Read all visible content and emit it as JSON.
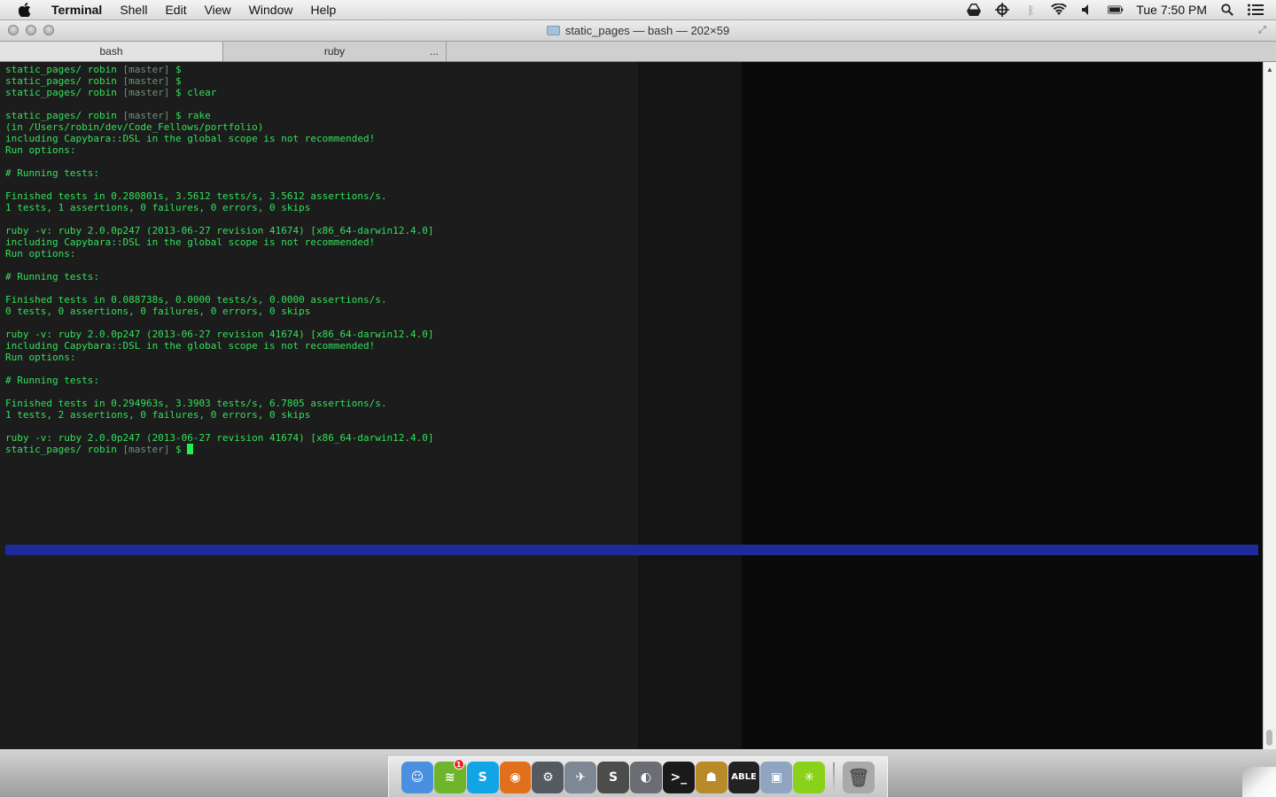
{
  "menubar": {
    "app_name": "Terminal",
    "items": [
      "Shell",
      "Edit",
      "View",
      "Window",
      "Help"
    ],
    "clock": "Tue 7:50 PM"
  },
  "window": {
    "title": "static_pages — bash — 202×59",
    "tabs": [
      {
        "label": "bash",
        "active": true
      },
      {
        "label": "ruby",
        "active": false,
        "extra": "..."
      }
    ]
  },
  "terminal": {
    "lines": [
      [
        {
          "t": "static_pages/ robin "
        },
        {
          "t": "[master]",
          "d": true
        },
        {
          "t": " $"
        }
      ],
      [
        {
          "t": "static_pages/ robin "
        },
        {
          "t": "[master]",
          "d": true
        },
        {
          "t": " $"
        }
      ],
      [
        {
          "t": "static_pages/ robin "
        },
        {
          "t": "[master]",
          "d": true
        },
        {
          "t": " $ clear"
        }
      ],
      [],
      [
        {
          "t": "static_pages/ robin "
        },
        {
          "t": "[master]",
          "d": true
        },
        {
          "t": " $ rake"
        }
      ],
      [
        {
          "t": "(in /Users/robin/dev/Code_Fellows/portfolio)"
        }
      ],
      [
        {
          "t": "including Capybara::DSL in the global scope is not recommended!"
        }
      ],
      [
        {
          "t": "Run options:"
        }
      ],
      [],
      [
        {
          "t": "# Running tests:"
        }
      ],
      [],
      [
        {
          "t": "Finished tests in 0.280801s, 3.5612 tests/s, 3.5612 assertions/s."
        }
      ],
      [
        {
          "t": "1 tests, 1 assertions, 0 failures, 0 errors, 0 skips"
        }
      ],
      [],
      [
        {
          "t": "ruby -v: ruby 2.0.0p247 (2013-06-27 revision 41674) [x86_64-darwin12.4.0]"
        }
      ],
      [
        {
          "t": "including Capybara::DSL in the global scope is not recommended!"
        }
      ],
      [
        {
          "t": "Run options:"
        }
      ],
      [],
      [
        {
          "t": "# Running tests:"
        }
      ],
      [],
      [
        {
          "t": "Finished tests in 0.088738s, 0.0000 tests/s, 0.0000 assertions/s."
        }
      ],
      [
        {
          "t": "0 tests, 0 assertions, 0 failures, 0 errors, 0 skips"
        }
      ],
      [],
      [
        {
          "t": "ruby -v: ruby 2.0.0p247 (2013-06-27 revision 41674) [x86_64-darwin12.4.0]"
        }
      ],
      [
        {
          "t": "including Capybara::DSL in the global scope is not recommended!"
        }
      ],
      [
        {
          "t": "Run options:"
        }
      ],
      [],
      [
        {
          "t": "# Running tests:"
        }
      ],
      [],
      [
        {
          "t": "Finished tests in 0.294963s, 3.3903 tests/s, 6.7805 assertions/s."
        }
      ],
      [
        {
          "t": "1 tests, 2 assertions, 0 failures, 0 errors, 0 skips"
        }
      ],
      [],
      [
        {
          "t": "ruby -v: ruby 2.0.0p247 (2013-06-27 revision 41674) [x86_64-darwin12.4.0]"
        }
      ],
      [
        {
          "t": "static_pages/ robin "
        },
        {
          "t": "[master]",
          "d": true
        },
        {
          "t": " $ "
        }
      ]
    ]
  },
  "dock": {
    "apps": [
      {
        "name": "finder-icon",
        "color": "#4a8fe0",
        "glyph": "☺"
      },
      {
        "name": "spotify-icon",
        "color": "#6fb52c",
        "glyph": "≋",
        "badge": "1"
      },
      {
        "name": "skype-icon",
        "color": "#12a5e6",
        "glyph": "S"
      },
      {
        "name": "firefox-icon",
        "color": "#e0701c",
        "glyph": "◉"
      },
      {
        "name": "steam-icon",
        "color": "#555a60",
        "glyph": "⚙"
      },
      {
        "name": "mail-icon",
        "color": "#7d8894",
        "glyph": "✈"
      },
      {
        "name": "sublime-text-icon",
        "color": "#4c4c4c",
        "glyph": "S"
      },
      {
        "name": "dashboard-icon",
        "color": "#6a6e74",
        "glyph": "◐"
      },
      {
        "name": "terminal-icon",
        "color": "#1a1a1a",
        "glyph": ">_"
      },
      {
        "name": "hubot-icon",
        "color": "#b88a2a",
        "glyph": "☗"
      },
      {
        "name": "able-icon",
        "color": "#222",
        "glyph": "ABLE"
      },
      {
        "name": "preview-icon",
        "color": "#8fa5c2",
        "glyph": "▣"
      },
      {
        "name": "limechat-icon",
        "color": "#8ad11c",
        "glyph": "✳"
      }
    ],
    "trash": {
      "name": "trash-icon",
      "color": "#a9a9a9",
      "glyph": "🗑"
    }
  }
}
